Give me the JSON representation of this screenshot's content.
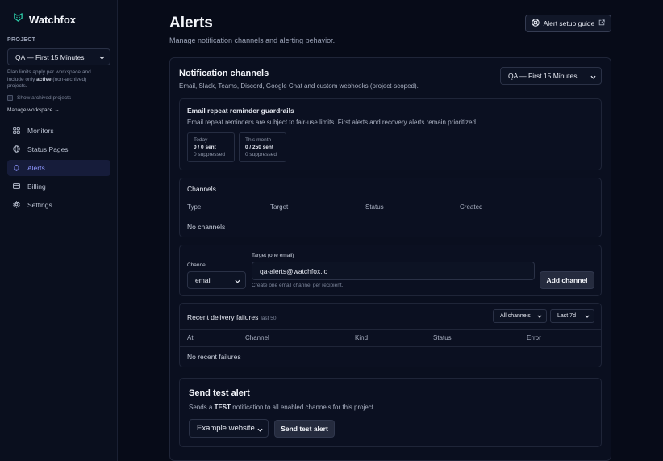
{
  "brand": {
    "name": "Watchfox",
    "logo_icon": "fox-logo-icon",
    "accent": "#2bc8a5"
  },
  "sidebar": {
    "project_label": "PROJECT",
    "project_select": "QA — First 15 Minutes",
    "plan_note_pre": "Plan limits apply per workspace and include only ",
    "plan_note_bold": "active",
    "plan_note_post": " (non-archived) projects.",
    "show_archived": "Show archived projects",
    "manage_workspace": "Manage workspace →",
    "nav": [
      {
        "label": "Monitors",
        "icon": "grid-icon",
        "active": false
      },
      {
        "label": "Status Pages",
        "icon": "globe-icon",
        "active": false
      },
      {
        "label": "Alerts",
        "icon": "bell-icon",
        "active": true
      },
      {
        "label": "Billing",
        "icon": "credit-card-icon",
        "active": false
      },
      {
        "label": "Settings",
        "icon": "gear-icon",
        "active": false
      }
    ],
    "active_color": "#8f97ff"
  },
  "header": {
    "title": "Alerts",
    "subtitle": "Manage notification channels and alerting behavior.",
    "guide_button": "Alert setup guide"
  },
  "channels_card": {
    "title": "Notification channels",
    "subtitle": "Email, Slack, Teams, Discord, Google Chat and custom webhooks (project-scoped).",
    "project_select": "QA — First 15 Minutes",
    "guardrails": {
      "title": "Email repeat reminder guardrails",
      "description": "Email repeat reminders are subject to fair-use limits. First alerts and recovery alerts remain prioritized.",
      "today": {
        "label": "Today",
        "sent": "0 / 0 sent",
        "suppressed": "0 suppressed"
      },
      "month": {
        "label": "This month",
        "sent": "0 / 250 sent",
        "suppressed": "0 suppressed"
      }
    },
    "channels_table": {
      "title": "Channels",
      "columns": [
        "Type",
        "Target",
        "Status",
        "Created"
      ],
      "empty": "No channels"
    },
    "add_channel": {
      "channel_label": "Channel",
      "channel_value": "email",
      "target_label": "Target (one email)",
      "target_value": "qa-alerts@watchfox.io",
      "hint": "Create one email channel per recipient.",
      "button": "Add channel"
    },
    "failures": {
      "title": "Recent delivery failures",
      "subtitle": "last 50",
      "filter_channel": "All channels",
      "filter_range": "Last 7d",
      "columns": [
        "At",
        "Channel",
        "Kind",
        "Status",
        "Error"
      ],
      "empty": "No recent failures"
    },
    "send_test": {
      "title": "Send test alert",
      "desc_pre": "Sends a ",
      "desc_bold": "TEST",
      "desc_post": " notification to all enabled channels for this project.",
      "select_value": "Example website",
      "button": "Send test alert"
    }
  }
}
